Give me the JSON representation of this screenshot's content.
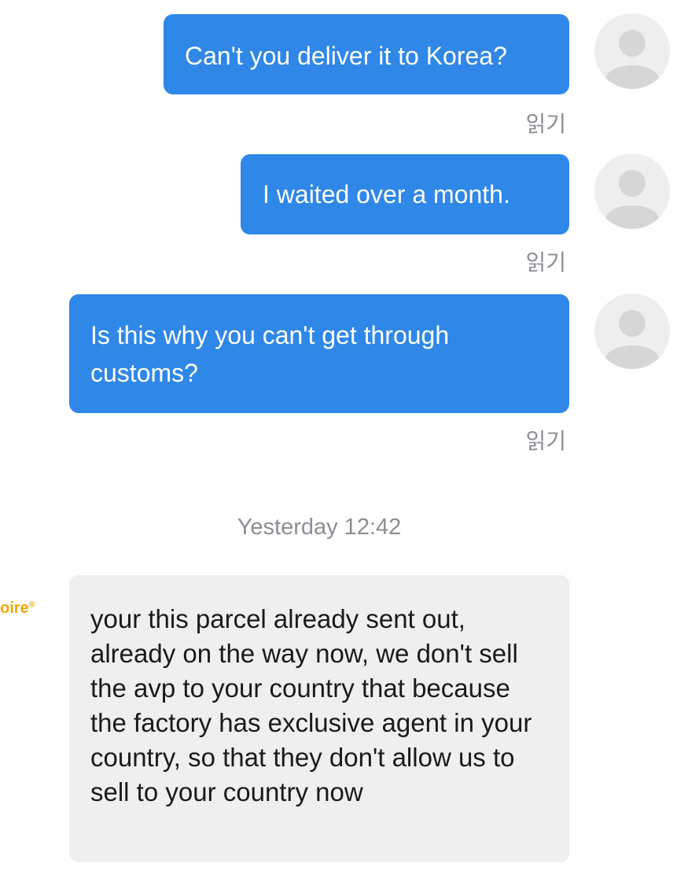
{
  "messages": [
    {
      "text": "Can't you deliver it to Korea?",
      "status": "읽기"
    },
    {
      "text": "I waited over a month.",
      "status": "읽기"
    },
    {
      "text": "Is this why you can't get through customs?",
      "status": "읽기"
    }
  ],
  "divider": {
    "timestamp": "Yesterday 12:42"
  },
  "incoming": {
    "sender_logo_fragment": "oire",
    "text": "your this parcel already sent out, already on the way now, we don't sell the avp to your country that because the factory has exclusive agent in your country, so that they don't allow us to sell to your country now"
  },
  "colors": {
    "outgoing_bubble": "#2f87e8",
    "incoming_bubble": "#efefef",
    "read_status": "#8d8d94",
    "brand": "#f0a500"
  },
  "icons": {
    "avatar": "default-user-avatar-icon"
  }
}
